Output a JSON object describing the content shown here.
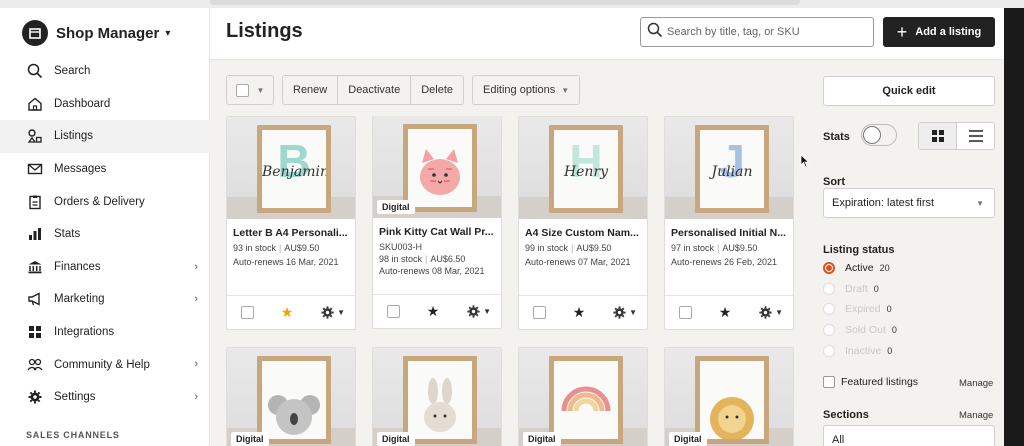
{
  "sidebar": {
    "brand": "Shop Manager",
    "items": [
      {
        "label": "Search"
      },
      {
        "label": "Dashboard"
      },
      {
        "label": "Listings"
      },
      {
        "label": "Messages"
      },
      {
        "label": "Orders & Delivery"
      },
      {
        "label": "Stats"
      },
      {
        "label": "Finances"
      },
      {
        "label": "Marketing"
      },
      {
        "label": "Integrations"
      },
      {
        "label": "Community & Help"
      },
      {
        "label": "Settings"
      }
    ],
    "sales_channels": "SALES CHANNELS"
  },
  "header": {
    "title": "Listings",
    "search_placeholder": "Search by title, tag, or SKU",
    "add_label": "Add a listing"
  },
  "toolbar": {
    "renew": "Renew",
    "deactivate": "Deactivate",
    "delete": "Delete",
    "editing": "Editing options"
  },
  "listings": [
    {
      "title": "Letter B A4 Personali...",
      "sku": "",
      "stock": "93 in stock",
      "price": "AU$9.50",
      "renew": "Auto-renews 16 Mar, 2021",
      "letter": "B",
      "letter_color": "#8fd4c8",
      "script": "Benjamin",
      "digital": "",
      "starred": true
    },
    {
      "title": "Pink Kitty Cat Wall Pr...",
      "sku": "SKU003-H",
      "stock": "98 in stock",
      "price": "AU$6.50",
      "renew": "Auto-renews 08 Mar, 2021",
      "letter": "",
      "letter_color": "",
      "script": "",
      "digital": "Digital",
      "starred": false
    },
    {
      "title": "A4 Size Custom Nam...",
      "sku": "",
      "stock": "99 in stock",
      "price": "AU$9.50",
      "renew": "Auto-renews 07 Mar, 2021",
      "letter": "H",
      "letter_color": "#b9e3d8",
      "script": "Henry",
      "digital": "",
      "starred": false
    },
    {
      "title": "Personalised Initial N...",
      "sku": "",
      "stock": "97 in stock",
      "price": "AU$9.50",
      "renew": "Auto-renews 26 Feb, 2021",
      "letter": "J",
      "letter_color": "#9bb8e0",
      "script": "Julian",
      "digital": "",
      "starred": false
    }
  ],
  "listings_row2": [
    {
      "digital": "Digital"
    },
    {
      "digital": "Digital"
    },
    {
      "digital": "Digital"
    },
    {
      "digital": "Digital"
    }
  ],
  "panel": {
    "quick_edit": "Quick edit",
    "stats": "Stats",
    "sort_label": "Sort",
    "sort_value": "Expiration: latest first",
    "listing_status": "Listing status",
    "statuses": [
      {
        "name": "Active",
        "count": "20"
      },
      {
        "name": "Draft",
        "count": "0"
      },
      {
        "name": "Expired",
        "count": "0"
      },
      {
        "name": "Sold Out",
        "count": "0"
      },
      {
        "name": "Inactive",
        "count": "0"
      }
    ],
    "featured": "Featured listings",
    "manage": "Manage",
    "sections": "Sections",
    "sections_value": "All"
  },
  "colors": {
    "accent": "#d9541e",
    "dark": "#222222",
    "bg": "#f4f2ee"
  }
}
